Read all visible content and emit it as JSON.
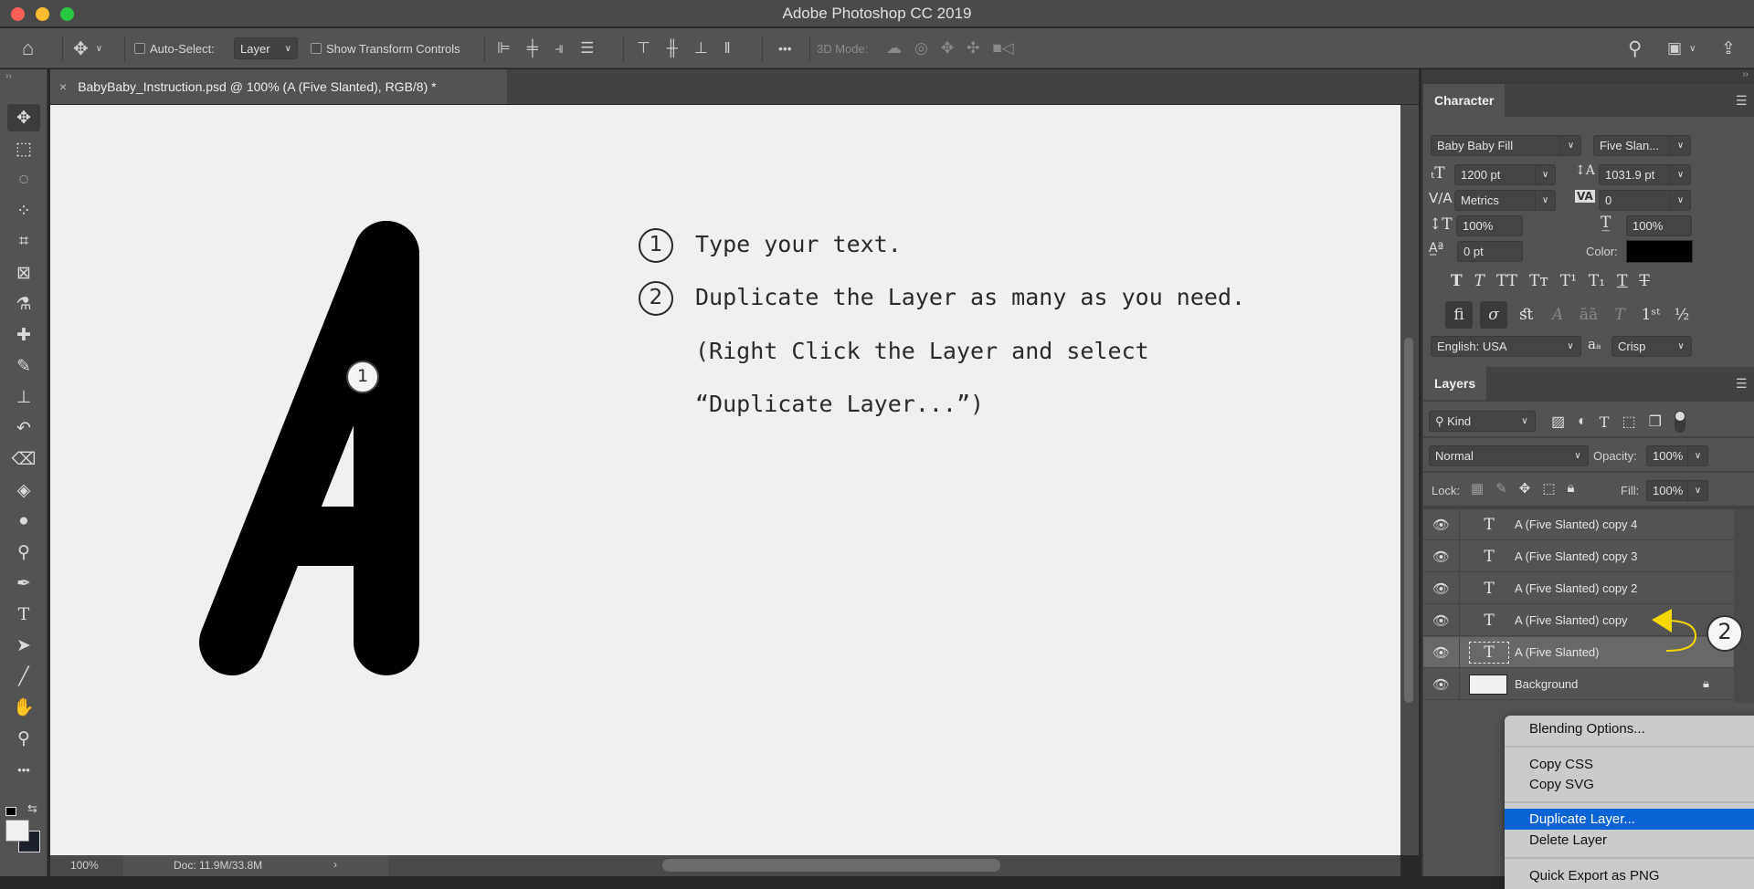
{
  "app": {
    "title": "Adobe Photoshop CC 2019"
  },
  "toolbar": {
    "auto_select_label": "Auto-Select:",
    "auto_select_value": "Layer",
    "show_transform_label": "Show Transform Controls",
    "mode_3d_label": "3D Mode:"
  },
  "document": {
    "tab_title": "BabyBaby_Instruction.psd @ 100% (A (Five Slanted), RGB/8) *",
    "zoom": "100%",
    "doc_size": "Doc: 11.9M/33.8M"
  },
  "canvas": {
    "marker_1": "1",
    "steps": [
      {
        "num": "1",
        "text": "Type your text."
      },
      {
        "num": "2",
        "text": "Duplicate the Layer as many as you need."
      }
    ],
    "line3": "(Right Click the Layer and select",
    "line4": "“Duplicate Layer...”)"
  },
  "character": {
    "title": "Character",
    "font_family": "Baby Baby Fill",
    "font_style": "Five Slan...",
    "size": "1200 pt",
    "leading": "1031.9 pt",
    "kerning": "Metrics",
    "tracking": "0",
    "vscale": "100%",
    "hscale": "100%",
    "baseline": "0 pt",
    "color_label": "Color:",
    "text_color": "#000000",
    "language": "English: USA",
    "antialias": "Crisp",
    "aa_icon": "aₐ"
  },
  "layers": {
    "title": "Layers",
    "filter": "Kind",
    "blend_mode": "Normal",
    "opacity_label": "Opacity:",
    "opacity": "100%",
    "lock_label": "Lock:",
    "fill_label": "Fill:",
    "fill": "100%",
    "items": [
      {
        "name": "A (Five Slanted) copy 4",
        "type": "text"
      },
      {
        "name": "A (Five Slanted) copy 3",
        "type": "text"
      },
      {
        "name": "A (Five Slanted) copy 2",
        "type": "text"
      },
      {
        "name": "A (Five Slanted) copy",
        "type": "text"
      },
      {
        "name": "A (Five Slanted)",
        "type": "text",
        "selected": true
      },
      {
        "name": "Background",
        "type": "image",
        "locked": true
      }
    ],
    "marker_2": "2",
    "arrow_color": "#f5d800"
  },
  "context_menu": {
    "items": [
      "Blending Options...",
      "Copy CSS",
      "Copy SVG",
      "Duplicate Layer...",
      "Delete Layer",
      "Quick Export as PNG"
    ],
    "highlighted": "Duplicate Layer...",
    "highlight_color": "#0b63d6"
  }
}
